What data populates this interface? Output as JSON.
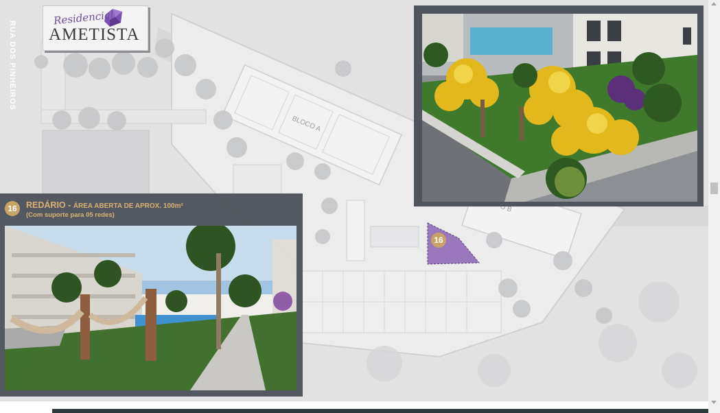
{
  "brand": {
    "script": "Residencial",
    "name": "AMETISTA"
  },
  "street": {
    "name": "RUA DOS PINHEIROS"
  },
  "map": {
    "block_a_label": "BLOCO A",
    "block_b_label": "O B",
    "marker_number": "16",
    "highlight_color": "#8a63b4"
  },
  "feature": {
    "number": "16",
    "title": "REDÁRIO -",
    "subtitle": "ÁREA ABERTA DE APROX. 100m²",
    "note": "(Com suporte para 05 redes)"
  },
  "colors": {
    "accent_gold": "#c9a266",
    "brand_purple": "#6f4ba0",
    "card_frame": "#50555d"
  }
}
